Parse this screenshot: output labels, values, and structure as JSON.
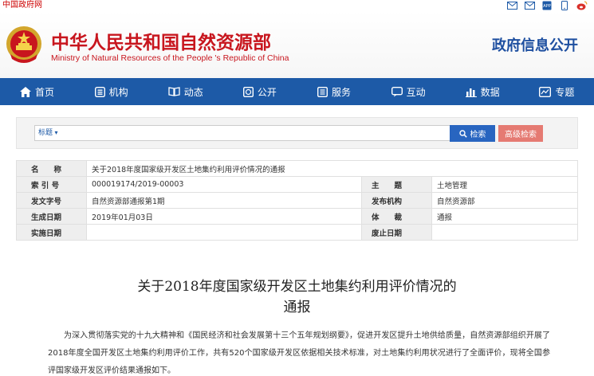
{
  "topbar": {
    "gov_link": "中国政府网",
    "icons": [
      "mail-icon",
      "mail-icon",
      "app-icon",
      "phone-icon",
      "weibo-icon"
    ],
    "app_label": "APP"
  },
  "header": {
    "site_name_cn": "中华人民共和国自然资源部",
    "site_name_en": "Ministry of Natural Resources of the People 's Republic of China",
    "section_title": "政府信息公开"
  },
  "nav": {
    "items": [
      {
        "label": "首页",
        "icon": "home-icon"
      },
      {
        "label": "机构",
        "icon": "org-icon"
      },
      {
        "label": "动态",
        "icon": "book-icon"
      },
      {
        "label": "公开",
        "icon": "globe-icon"
      },
      {
        "label": "服务",
        "icon": "service-icon"
      },
      {
        "label": "互动",
        "icon": "chat-icon"
      },
      {
        "label": "数据",
        "icon": "bar-chart-icon"
      },
      {
        "label": "专题",
        "icon": "topic-icon"
      }
    ]
  },
  "search": {
    "select_value": "标题",
    "search_label": "检索",
    "advanced_label": "高级检索"
  },
  "meta": {
    "name_key": "名　　称",
    "name_value": "关于2018年度国家级开发区土地集约利用评价情况的通报",
    "index_key": "索 引 号",
    "index_value": "000019174/2019-00003",
    "subject_key": "主　　题",
    "subject_value": "土地管理",
    "docno_key": "发文字号",
    "docno_value": "自然资源部通报第1期",
    "issuer_key": "发布机构",
    "issuer_value": "自然资源部",
    "date_key": "生成日期",
    "date_value": "2019年01月03日",
    "genre_key": "体　　裁",
    "genre_value": "通报",
    "effective_key": "实施日期",
    "effective_value": "",
    "expire_key": "废止日期",
    "expire_value": ""
  },
  "article": {
    "title_line1": "关于2018年度国家级开发区土地集约利用评价情况的",
    "title_line2": "通报",
    "paragraph": "为深入贯彻落实党的十九大精神和《国民经济和社会发展第十三个五年规划纲要》，促进开发区提升土地供给质量，自然资源部组织开展了2018年度全国开发区土地集约利用评价工作，共有520个国家级开发区依据相关技术标准，对土地集约利用状况进行了全面评价，现将全国参评国家级开发区评价结果通报如下。"
  },
  "colors": {
    "brand_red": "#c8161e",
    "nav_blue": "#1d5aa7",
    "search_blue": "#2865c0",
    "advanced_red": "#e57a72"
  }
}
